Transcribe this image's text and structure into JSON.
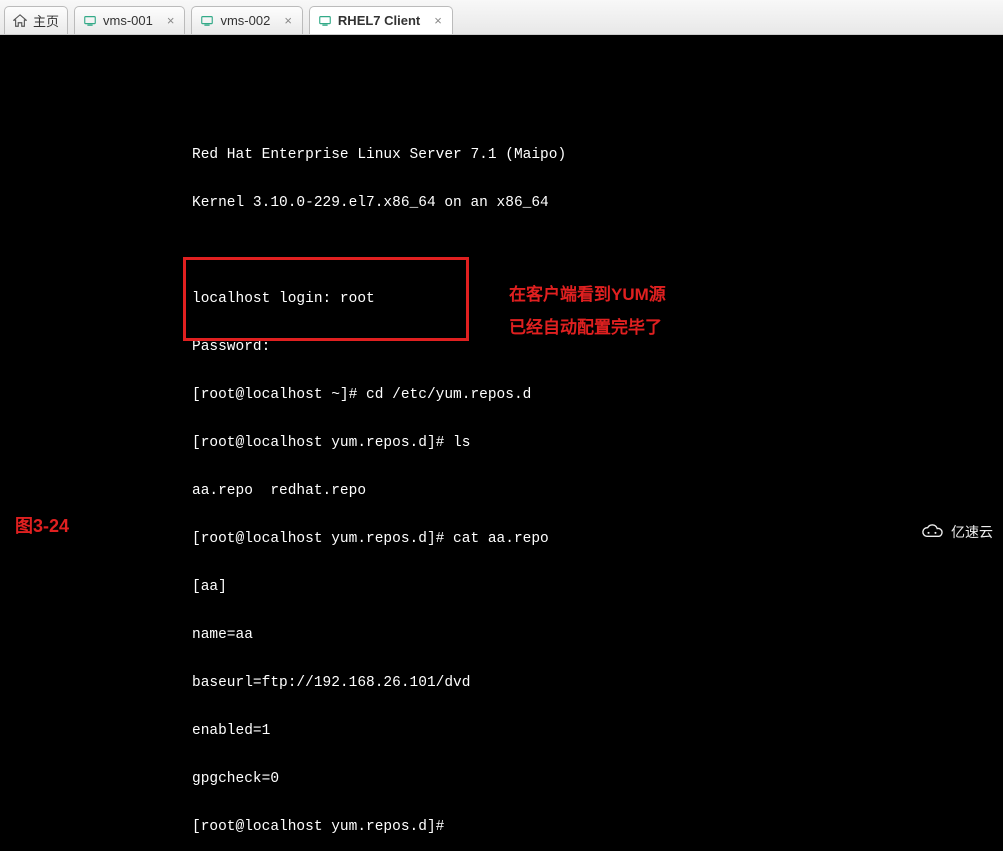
{
  "tabs": [
    {
      "label": "主页",
      "icon": "home-icon",
      "active": false,
      "closable": false
    },
    {
      "label": "vms-001",
      "icon": "vm-icon",
      "active": false,
      "closable": true
    },
    {
      "label": "vms-002",
      "icon": "vm-icon",
      "active": false,
      "closable": true
    },
    {
      "label": "RHEL7 Client",
      "icon": "vm-icon",
      "active": true,
      "closable": true
    }
  ],
  "terminal": {
    "lines": [
      "Red Hat Enterprise Linux Server 7.1 (Maipo)",
      "Kernel 3.10.0-229.el7.x86_64 on an x86_64",
      "",
      "localhost login: root",
      "Password:",
      "[root@localhost ~]# cd /etc/yum.repos.d",
      "[root@localhost yum.repos.d]# ls",
      "aa.repo  redhat.repo",
      "[root@localhost yum.repos.d]# cat aa.repo",
      "[aa]",
      "name=aa",
      "baseurl=ftp://192.168.26.101/dvd",
      "enabled=1",
      "gpgcheck=0",
      "[root@localhost yum.repos.d]#"
    ]
  },
  "annotation": {
    "line1": "在客户端看到YUM源",
    "line2": "已经自动配置完毕了"
  },
  "figureLabel": "图3-24",
  "watermark": "亿速云",
  "closeGlyph": "×"
}
